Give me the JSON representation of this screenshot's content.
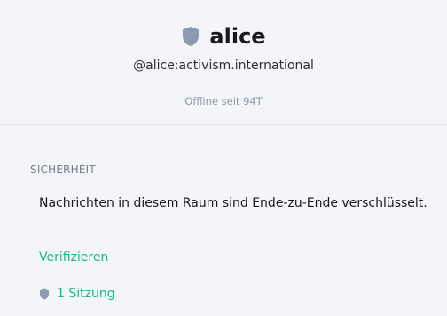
{
  "user": {
    "display_name": "alice",
    "user_id": "@alice:activism.international",
    "presence": "Offline seit 94T"
  },
  "security": {
    "heading": "SICHERHEIT",
    "encryption_text": "Nachrichten in diesem Raum sind Ende-zu-Ende verschlüsselt.",
    "verify_label": "Verifizieren",
    "sessions_label": "1 Sitzung"
  },
  "icons": {
    "header_icon": "shield-icon",
    "sessions_icon": "shield-icon"
  },
  "colors": {
    "background": "#f3f5f8",
    "accent": "#0dbd8b",
    "shield": "#8e99b4"
  }
}
